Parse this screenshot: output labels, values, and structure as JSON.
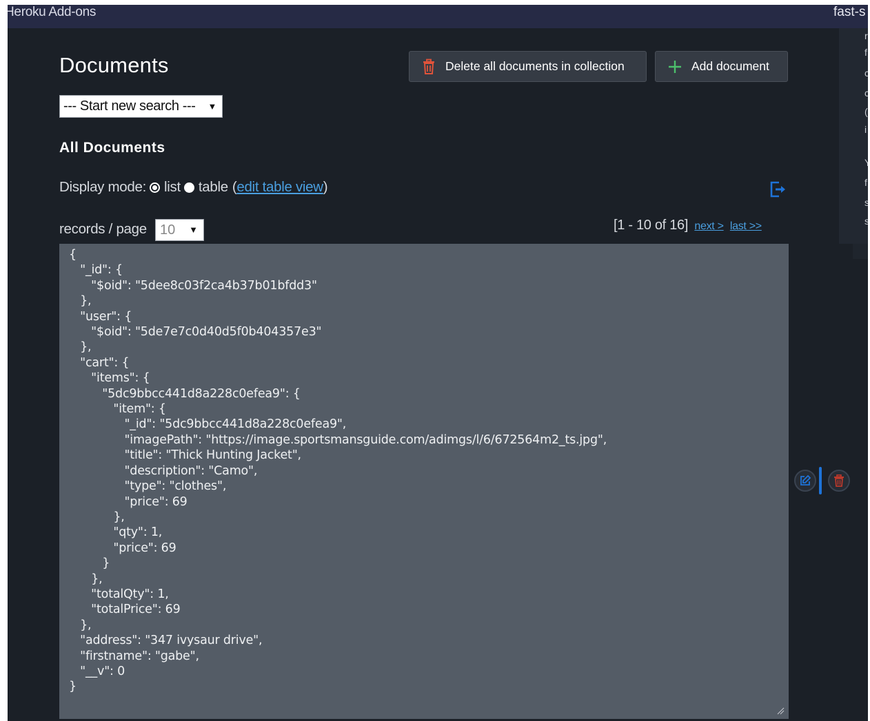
{
  "topbar": {
    "title": "Heroku Add-ons",
    "app_name": "fast-s"
  },
  "side_panel": {
    "fragments": [
      "r",
      "f",
      "c",
      "c",
      "(",
      "i",
      "Y",
      "f",
      "s",
      "s"
    ]
  },
  "page": {
    "title": "Documents",
    "section_title": "All Documents"
  },
  "toolbar": {
    "delete_all_label": "Delete all documents in collection",
    "add_label": "Add document"
  },
  "search": {
    "selected": "--- Start new search ---"
  },
  "display_mode": {
    "label": "Display mode:",
    "list_label": "list",
    "table_label": "table",
    "open_paren": "(",
    "edit_table_view": "edit table view",
    "close_paren": ")",
    "selected": "list"
  },
  "records_per_page": {
    "label": "records / page",
    "selected": "10"
  },
  "pagination": {
    "range": "[1 - 10 of 16]",
    "next_label": "next >",
    "last_label": "last >>"
  },
  "document": {
    "text": "{\n   \"_id\": {\n      \"$oid\": \"5dee8c03f2ca4b37b01bfdd3\"\n   },\n   \"user\": {\n      \"$oid\": \"5de7e7c0d40d5f0b404357e3\"\n   },\n   \"cart\": {\n      \"items\": {\n         \"5dc9bbcc441d8a228c0efea9\": {\n            \"item\": {\n               \"_id\": \"5dc9bbcc441d8a228c0efea9\",\n               \"imagePath\": \"https://image.sportsmansguide.com/adimgs/l/6/672564m2_ts.jpg\",\n               \"title\": \"Thick Hunting Jacket\",\n               \"description\": \"Camo\",\n               \"type\": \"clothes\",\n               \"price\": 69\n            },\n            \"qty\": 1,\n            \"price\": 69\n         }\n      },\n      \"totalQty\": 1,\n      \"totalPrice\": 69\n   },\n   \"address\": \"347 ivysaur drive\",\n   \"firstname\": \"gabe\",\n   \"__v\": 0\n}"
  },
  "colors": {
    "background": "#1b2027",
    "topbar": "#262a45",
    "json_box": "#545c66",
    "danger": "#e0533a",
    "success": "#4cbf6b",
    "link": "#4a9fe0",
    "accent_blue": "#1e73d8"
  },
  "icons": {
    "delete_all": "trash-icon",
    "add": "plus-icon",
    "export": "export-icon",
    "edit": "edit-icon",
    "delete": "trash-icon"
  }
}
